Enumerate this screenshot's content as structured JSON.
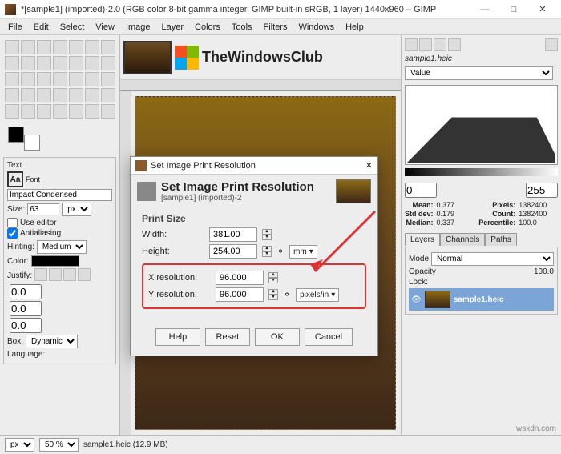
{
  "window": {
    "title": "*[sample1] (imported)-2.0 (RGB color 8-bit gamma integer, GIMP built-in sRGB, 1 layer) 1440x960 – GIMP"
  },
  "menu": [
    "File",
    "Edit",
    "Select",
    "View",
    "Image",
    "Layer",
    "Colors",
    "Tools",
    "Filters",
    "Windows",
    "Help"
  ],
  "logo_text": "TheWindowsClub",
  "text_panel": {
    "title": "Text",
    "font_label": "Font",
    "font_value": "Impact Condensed",
    "size_label": "Size:",
    "size_value": "63",
    "size_unit": "px",
    "use_editor": "Use editor",
    "antialias": "Antialiasing",
    "hinting_label": "Hinting:",
    "hinting_value": "Medium",
    "color_label": "Color:",
    "justify_label": "Justify:",
    "spacing1": "0.0",
    "spacing2": "0.0",
    "spacing3": "0.0",
    "box_label": "Box:",
    "box_value": "Dynamic",
    "lang_label": "Language:"
  },
  "right": {
    "filename": "sample1.heic",
    "channel_value": "Value",
    "range_lo": "0",
    "range_hi": "255",
    "stats": {
      "mean_k": "Mean:",
      "mean_v": "0.377",
      "std_k": "Std dev:",
      "std_v": "0.179",
      "median_k": "Median:",
      "median_v": "0.337",
      "pixels_k": "Pixels:",
      "pixels_v": "1382400",
      "count_k": "Count:",
      "count_v": "1382400",
      "perc_k": "Percentile:",
      "perc_v": "100.0"
    },
    "tab_layers": "Layers",
    "tab_channels": "Channels",
    "tab_paths": "Paths",
    "mode_label": "Mode",
    "mode_value": "Normal",
    "opacity_label": "Opacity",
    "opacity_value": "100.0",
    "lock_label": "Lock:",
    "layer_name": "sample1.heic"
  },
  "dialog": {
    "title": "Set Image Print Resolution",
    "heading": "Set Image Print Resolution",
    "sub": "[sample1] (imported)-2",
    "group": "Print Size",
    "width_label": "Width:",
    "width_value": "381.00",
    "height_label": "Height:",
    "height_value": "254.00",
    "size_unit": "mm",
    "xres_label": "X resolution:",
    "xres_value": "96.000",
    "yres_label": "Y resolution:",
    "yres_value": "96.000",
    "res_unit": "pixels/in",
    "btn_help": "Help",
    "btn_reset": "Reset",
    "btn_ok": "OK",
    "btn_cancel": "Cancel"
  },
  "status": {
    "unit": "px",
    "zoom": "50 %",
    "file": "sample1.heic (12.9 MB)"
  },
  "watermark": "wsxdn.com"
}
